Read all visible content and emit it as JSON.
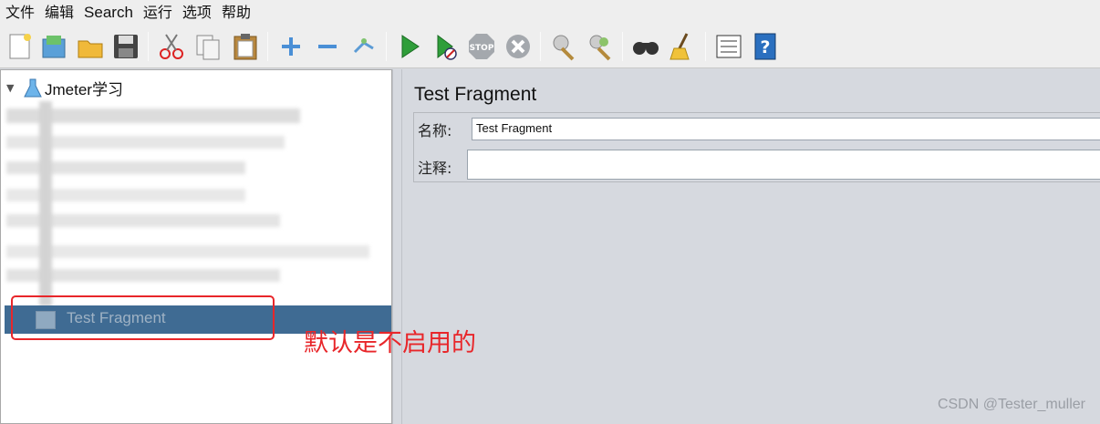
{
  "menu": {
    "items": [
      "文件",
      "编辑",
      "Search",
      "运行",
      "选项",
      "帮助"
    ]
  },
  "toolbar": {
    "icons": [
      "new-icon",
      "templates-icon",
      "open-icon",
      "save-icon",
      "cut-icon",
      "copy-icon",
      "paste-icon",
      "expand-icon",
      "collapse-icon",
      "toggle-icon",
      "start-icon",
      "start-no-pause-icon",
      "stop-icon",
      "shutdown-icon",
      "clear-icon",
      "clear-all-icon",
      "search-icon",
      "reset-search-icon",
      "function-helper-icon",
      "help-icon"
    ]
  },
  "tree": {
    "root_label": "Jmeter学习",
    "selected_label": "Test Fragment"
  },
  "panel": {
    "title": "Test Fragment",
    "name_label": "名称:",
    "name_value": "Test Fragment",
    "comment_label": "注释:",
    "comment_value": ""
  },
  "annotation": "默认是不启用的",
  "watermark": "CSDN @Tester_muller"
}
